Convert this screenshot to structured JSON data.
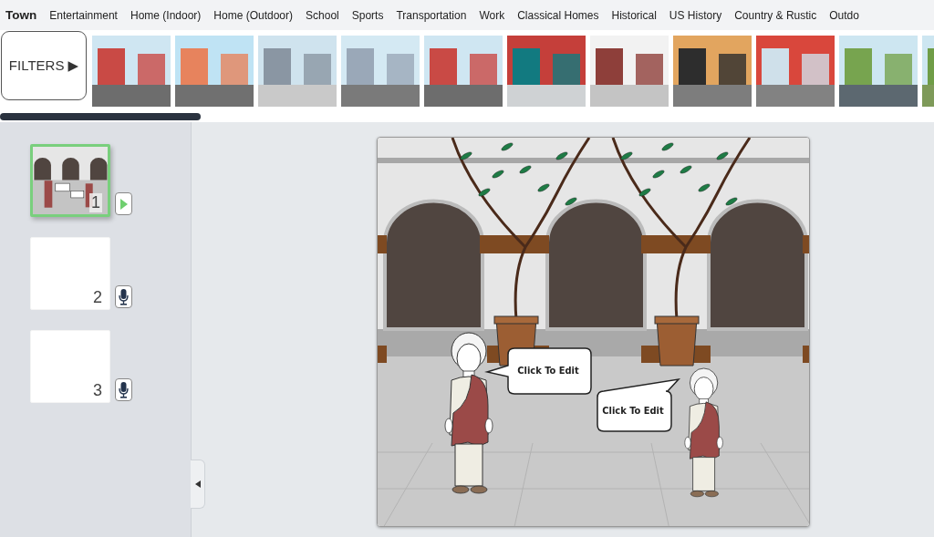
{
  "categories": [
    {
      "label": "Town",
      "selected": true
    },
    {
      "label": "Entertainment",
      "selected": false
    },
    {
      "label": "Home (Indoor)",
      "selected": false
    },
    {
      "label": "Home (Outdoor)",
      "selected": false
    },
    {
      "label": "School",
      "selected": false
    },
    {
      "label": "Sports",
      "selected": false
    },
    {
      "label": "Transportation",
      "selected": false
    },
    {
      "label": "Work",
      "selected": false
    },
    {
      "label": "Classical Homes",
      "selected": false
    },
    {
      "label": "Historical",
      "selected": false
    },
    {
      "label": "US History",
      "selected": false
    },
    {
      "label": "Country & Rustic",
      "selected": false
    },
    {
      "label": "Outdo",
      "selected": false
    }
  ],
  "filters_button": {
    "label": "FILTERS ▶"
  },
  "scene_thumbnails": [
    {
      "kind": "brick-street"
    },
    {
      "kind": "shops"
    },
    {
      "kind": "skyline"
    },
    {
      "kind": "park-corner"
    },
    {
      "kind": "brick-street"
    },
    {
      "kind": "front-door"
    },
    {
      "kind": "patio"
    },
    {
      "kind": "store-window"
    },
    {
      "kind": "alley"
    },
    {
      "kind": "parking-lot"
    },
    {
      "kind": "field"
    }
  ],
  "cells": [
    {
      "number": "1",
      "selected": true,
      "filled": true,
      "kind": "play"
    },
    {
      "number": "2",
      "selected": false,
      "filled": false,
      "kind": "record"
    },
    {
      "number": "3",
      "selected": false,
      "filled": false,
      "kind": "record"
    }
  ],
  "canvas": {
    "bubbles": [
      {
        "text": "Click To Edit"
      },
      {
        "text": "Click To Edit"
      }
    ]
  }
}
